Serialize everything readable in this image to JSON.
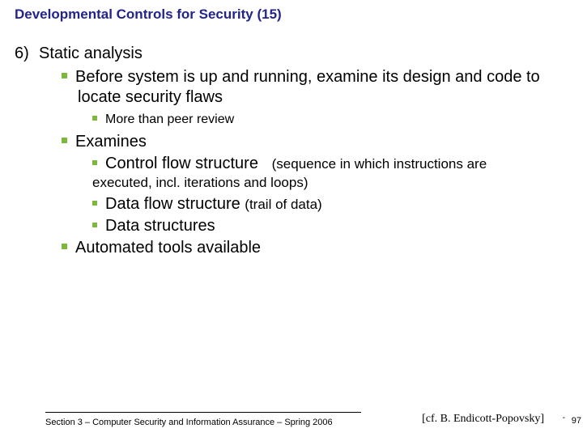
{
  "title": "Developmental Controls for Security (15)",
  "list_number": "6)",
  "item_main": "Static analysis",
  "b1": "Before system is up and running, examine its design and code to locate security flaws",
  "b1_a": "More than peer review",
  "b2": "Examines",
  "b2_a_main": "Control flow structure",
  "b2_a_paren": "(sequence in which instructions are",
  "b2_a_cont": "executed, incl. iterations and loops)",
  "b2_b_main": "Data flow structure",
  "b2_b_paren": "(trail of data)",
  "b2_c": "Data structures",
  "b3": "Automated tools available",
  "footer": "Section 3 – Computer Security and Information Assurance – Spring 2006",
  "citation": "[cf. B. Endicott-Popovsky]",
  "page": "97"
}
